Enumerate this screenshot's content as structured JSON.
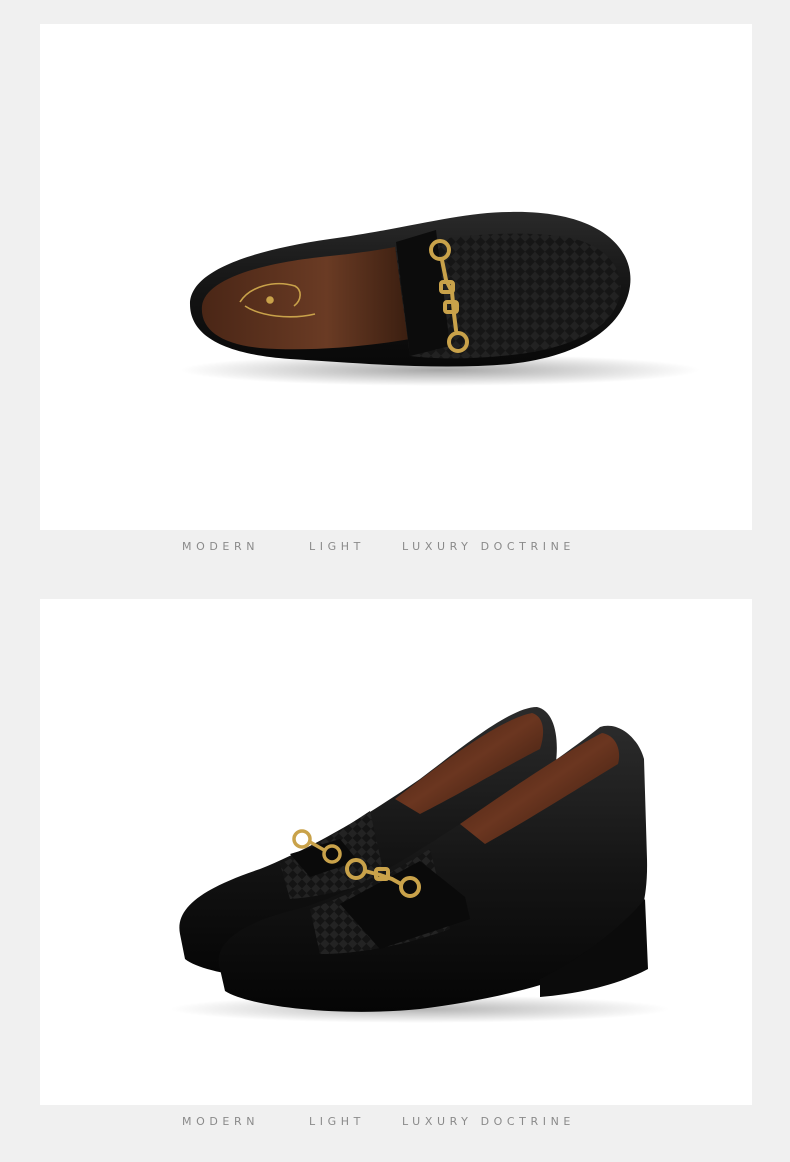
{
  "sections": [
    {
      "image": {
        "subject": "shoe-top-view",
        "colors": {
          "leather": "#141414",
          "lining": "#6a3b24",
          "hardware": "#c9a24a",
          "background": "#ffffff"
        }
      },
      "tagline": {
        "word1": "MODERN",
        "word2": "LIGHT",
        "word3": "LUXURY DOCTRINE"
      }
    },
    {
      "image": {
        "subject": "shoe-pair-side-view",
        "colors": {
          "leather": "#111111",
          "lining": "#5a2c18",
          "hardware": "#c9a24a",
          "background": "#ffffff"
        }
      },
      "tagline": {
        "word1": "MODERN",
        "word2": "LIGHT",
        "word3": "LUXURY DOCTRINE"
      }
    }
  ]
}
